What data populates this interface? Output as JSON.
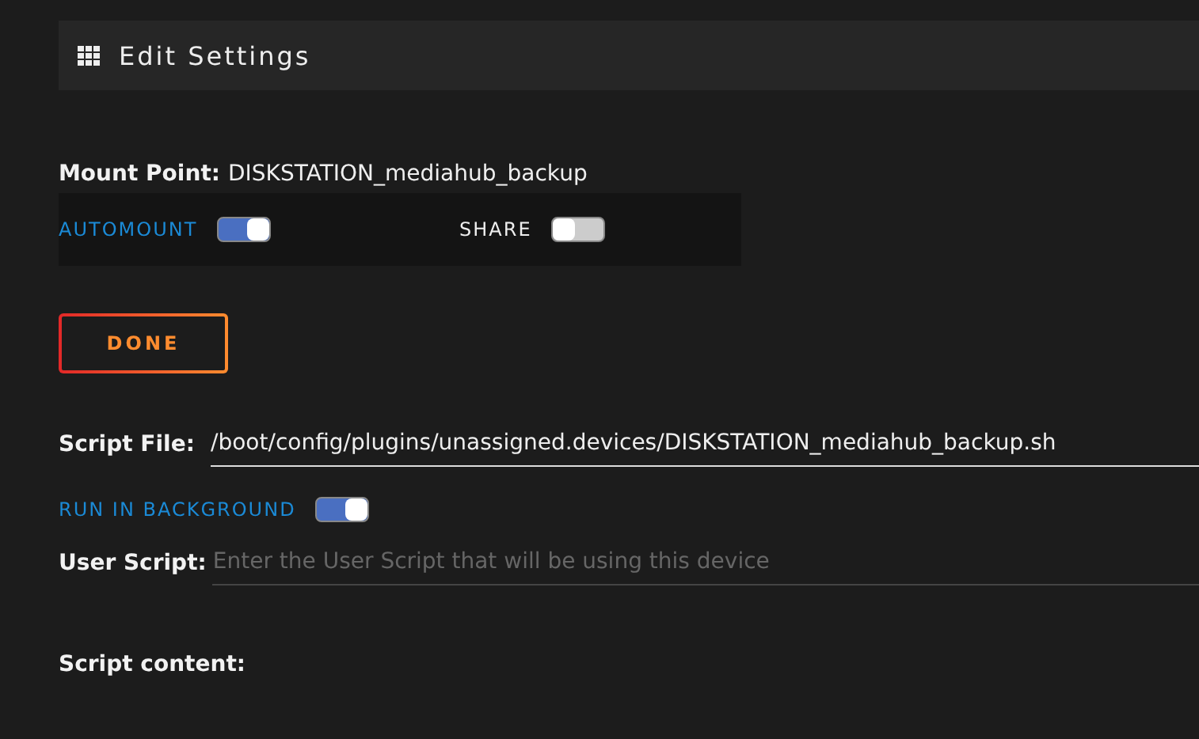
{
  "header": {
    "title": "Edit Settings"
  },
  "mount_point": {
    "label": "Mount Point:",
    "value": "DISKSTATION_mediahub_backup"
  },
  "toggles": [
    {
      "label": "AUTOMOUNT",
      "on": true,
      "highlight": true
    },
    {
      "label": "SHARE",
      "on": false,
      "highlight": false
    }
  ],
  "done_button": "DONE",
  "script_file": {
    "label": "Script File:",
    "value": "/boot/config/plugins/unassigned.devices/DISKSTATION_mediahub_backup.sh"
  },
  "run_in_background": {
    "label": "RUN IN BACKGROUND",
    "on": true
  },
  "user_script": {
    "label": "User Script:",
    "placeholder": "Enter the User Script that will be using this device"
  },
  "script_content": {
    "label": "Script content:"
  }
}
